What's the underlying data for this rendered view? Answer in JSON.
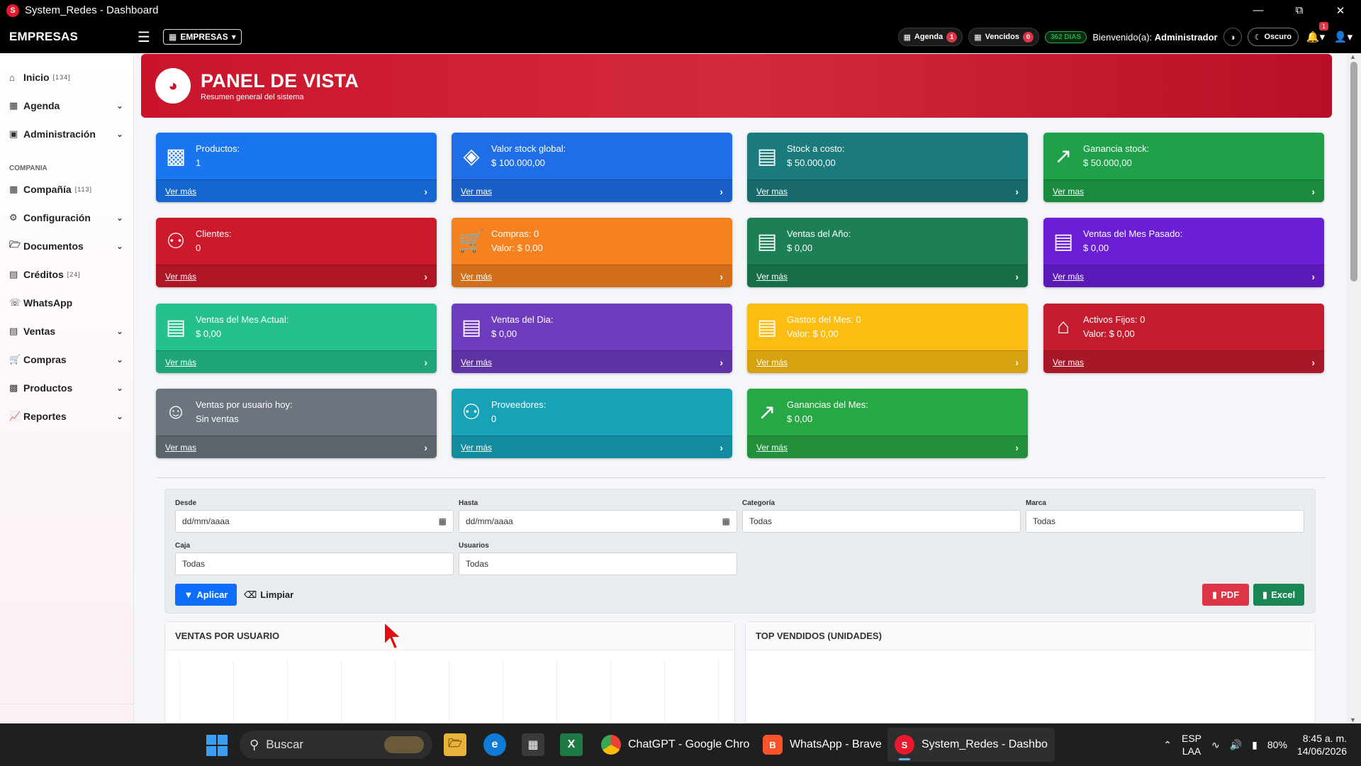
{
  "window": {
    "title": "System_Redes - Dashboard",
    "logo": "S"
  },
  "navbar": {
    "brand": "EMPRESAS",
    "empresas_btn": "EMPRESAS",
    "agenda_label": "Agenda",
    "agenda_count": "1",
    "vencidos_label": "Vencidos",
    "vencidos_count": "0",
    "days": "362 DIAS",
    "welcome_prefix": "Bienvenido(a):",
    "user": "Administrador",
    "dark_label": "Oscuro",
    "notif_count": "1"
  },
  "sidebar": {
    "items": [
      {
        "label": "Inicio",
        "count": "[134]",
        "icon": "home-icon",
        "chevron": false
      },
      {
        "label": "Agenda",
        "count": "",
        "icon": "calendar-icon",
        "chevron": true
      },
      {
        "label": "Administración",
        "count": "",
        "icon": "id-card-icon",
        "chevron": true
      }
    ],
    "section": "COMPANIA",
    "items2": [
      {
        "label": "Compañía",
        "count": "[113]",
        "icon": "building-icon",
        "chevron": false
      },
      {
        "label": "Configuración",
        "count": "",
        "icon": "gears-icon",
        "chevron": true
      },
      {
        "label": "Documentos",
        "count": "",
        "icon": "folder-icon",
        "chevron": true
      },
      {
        "label": "Créditos",
        "count": "[24]",
        "icon": "credit-card-icon",
        "chevron": false
      },
      {
        "label": "WhatsApp",
        "count": "",
        "icon": "whatsapp-icon",
        "chevron": false
      },
      {
        "label": "Ventas",
        "count": "",
        "icon": "cash-register-icon",
        "chevron": true
      },
      {
        "label": "Compras",
        "count": "",
        "icon": "cart-icon",
        "chevron": true
      },
      {
        "label": "Productos",
        "count": "",
        "icon": "boxes-icon",
        "chevron": true
      },
      {
        "label": "Reportes",
        "count": "",
        "icon": "chart-line-icon",
        "chevron": true
      }
    ]
  },
  "header": {
    "title": "PANEL DE VISTA",
    "subtitle": "Resumen general del sistema"
  },
  "cards": [
    {
      "line1": "Productos:",
      "line2": "1",
      "link": "Ver más",
      "color": "#1976f0",
      "icon": "boxes-icon"
    },
    {
      "line1": "Valor stock global:",
      "line2": "$ 100.000,00",
      "link": "Ver mas",
      "color": "#1f6ee8",
      "icon": "layers-icon"
    },
    {
      "line1": "Stock a costo:",
      "line2": "$ 50.000,00",
      "link": "Ver mas",
      "color": "#1a7a7c",
      "icon": "cash-register-icon"
    },
    {
      "line1": "Ganancia stock:",
      "line2": "$ 50.000,00",
      "link": "Ver mas",
      "color": "#1fa14a",
      "icon": "chart-line-icon"
    },
    {
      "line1": "Clientes:",
      "line2": "0",
      "link": "Ver más",
      "color": "#cc1a2c",
      "icon": "users-icon"
    },
    {
      "line1": "Compras: 0",
      "line2": "Valor: $ 0,00",
      "link": "Ver más",
      "color": "#f5821f",
      "icon": "cart-icon"
    },
    {
      "line1": "Ventas del Año:",
      "line2": "$ 0,00",
      "link": "Ver más",
      "color": "#1d7f55",
      "icon": "cash-register-icon"
    },
    {
      "line1": "Ventas del Mes Pasado:",
      "line2": "$ 0,00",
      "link": "Ver más",
      "color": "#6a1fd6",
      "icon": "cash-register-icon"
    },
    {
      "line1": "Ventas del Mes Actual:",
      "line2": "$ 0,00",
      "link": "Ver más",
      "color": "#24c18f",
      "icon": "cash-register-icon"
    },
    {
      "line1": "Ventas del Dia:",
      "line2": "$ 0,00",
      "link": "Ver más",
      "color": "#6f3cc0",
      "icon": "cash-register-icon"
    },
    {
      "line1": "Gastos del Mes: 0",
      "line2": "Valor: $ 0,00",
      "link": "Ver más",
      "color": "#fbbd12",
      "icon": "cash-register-icon"
    },
    {
      "line1": "Activos Fijos: 0",
      "line2": "Valor: $ 0,00",
      "link": "Ver mas",
      "color": "#c41b2f",
      "icon": "house-icon"
    },
    {
      "line1": "Ventas por usuario hoy:",
      "line2": "Sin ventas",
      "link": "Ver mas",
      "color": "#6c757d",
      "icon": "user-clock-icon"
    },
    {
      "line1": "Proveedores:",
      "line2": "0",
      "link": "Ver más",
      "color": "#17a2b8",
      "icon": "users-icon"
    },
    {
      "line1": "Ganancias del Mes:",
      "line2": "$ 0,00",
      "link": "Ver más",
      "color": "#28a745",
      "icon": "chart-line-icon"
    }
  ],
  "filters": {
    "desde_label": "Desde",
    "desde_value": "dd/mm/aaaa",
    "hasta_label": "Hasta",
    "hasta_value": "dd/mm/aaaa",
    "categoria_label": "Categoría",
    "categoria_value": "Todas",
    "marca_label": "Marca",
    "marca_value": "Todas",
    "caja_label": "Caja",
    "caja_value": "Todas",
    "usuarios_label": "Usuarios",
    "usuarios_value": "Todas",
    "apply": "Aplicar",
    "clear": "Limpiar",
    "pdf": "PDF",
    "excel": "Excel"
  },
  "panels": {
    "left_title": "VENTAS POR USUARIO",
    "right_title": "TOP VENDIDOS (UNIDADES)"
  },
  "taskbar": {
    "search": "Buscar",
    "apps": [
      {
        "label": "ChatGPT - Google Chro",
        "icon": "chrome-icon"
      },
      {
        "label": "WhatsApp - Brave",
        "icon": "brave-icon"
      },
      {
        "label": "System_Redes - Dashbo",
        "icon": "system-redes-icon"
      }
    ],
    "lang1": "ESP",
    "lang2": "LAA",
    "battery": "80%",
    "time": "8:45 a. m.",
    "date": "14/06/2026"
  }
}
